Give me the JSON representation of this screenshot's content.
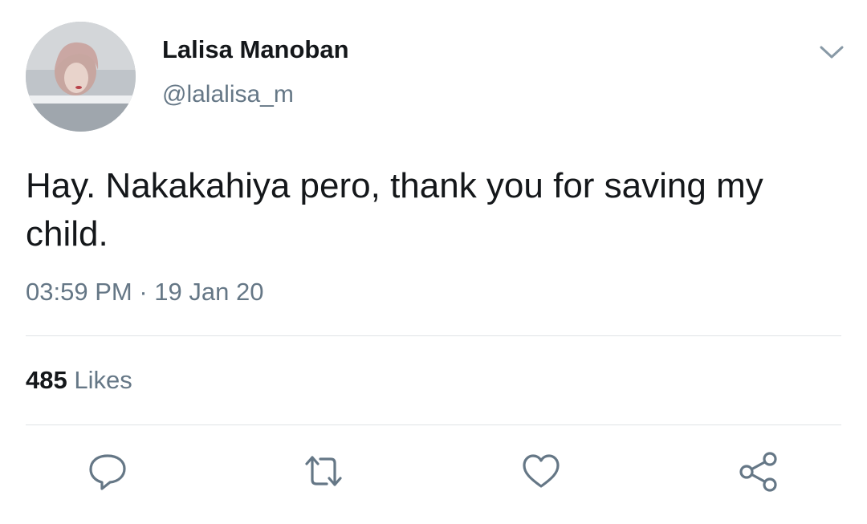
{
  "author": {
    "display_name": "Lalisa Manoban",
    "handle": "@lalalisa_m",
    "avatar_icon": "profile-photo"
  },
  "tweet": {
    "text": "Hay. Nakakahiya pero, thank you for saving my child.",
    "time": "03:59 PM",
    "separator": "·",
    "date": "19 Jan 20"
  },
  "stats": {
    "likes_count": "485",
    "likes_label": "Likes"
  },
  "actions": {
    "reply_icon": "speech-bubble-icon",
    "retweet_icon": "retweet-arrows-icon",
    "like_icon": "heart-icon",
    "share_icon": "share-nodes-icon",
    "menu_icon": "chevron-down-icon"
  },
  "colors": {
    "primary_text": "#14171a",
    "secondary_text": "#657786",
    "icon": "#657786",
    "divider": "#dfe3e6"
  }
}
